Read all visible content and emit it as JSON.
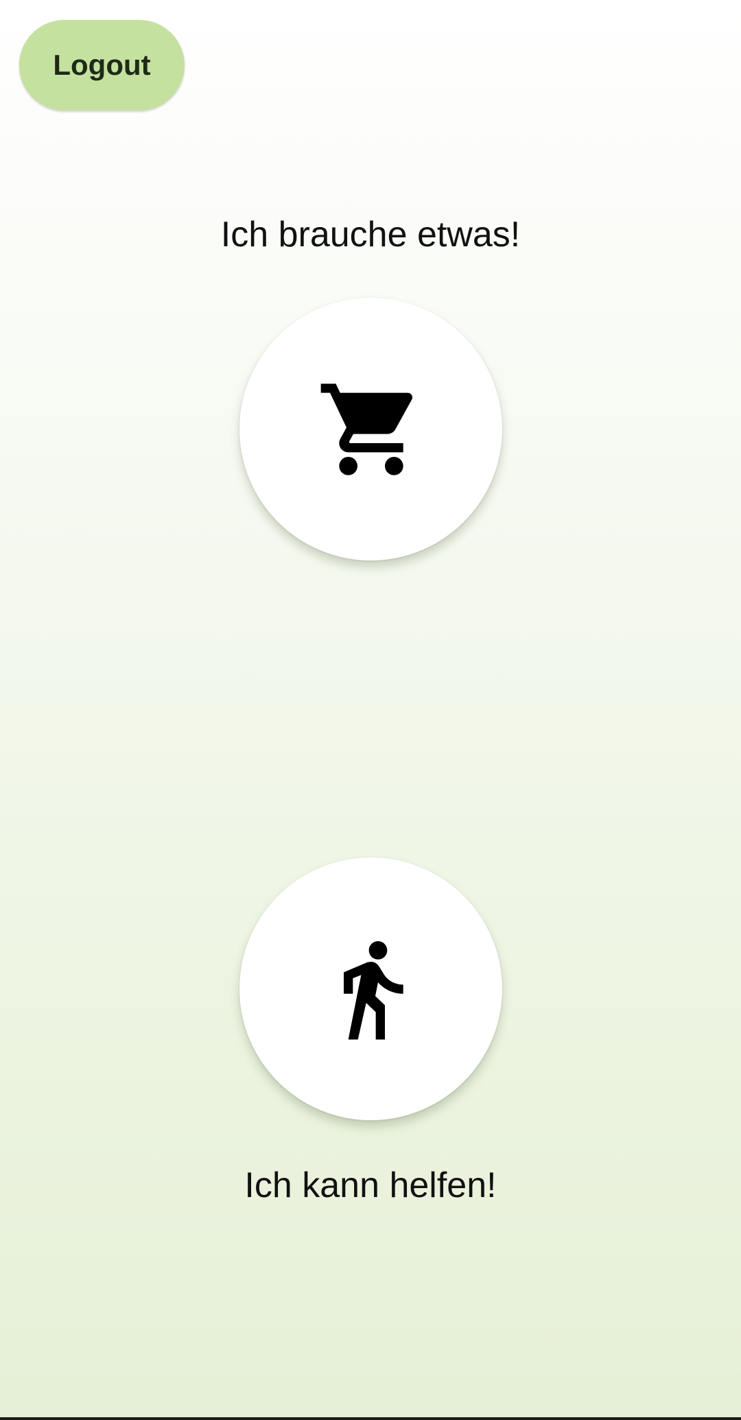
{
  "header": {
    "logout_label": "Logout"
  },
  "need_section": {
    "label": "Ich brauche etwas!",
    "icon": "shopping-cart-icon"
  },
  "help_section": {
    "label": "Ich kann helfen!",
    "icon": "walking-person-icon"
  },
  "colors": {
    "logout_button_bg": "#c5e1a0",
    "background_top": "#ffffff",
    "background_bottom": "#e6f0d6",
    "icon": "#000000"
  }
}
